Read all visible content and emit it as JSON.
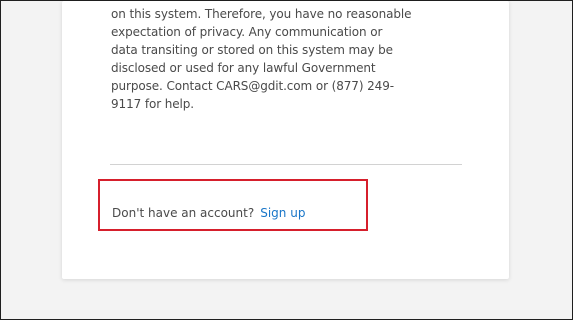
{
  "notice": {
    "lines": [
      "on this system. Therefore, you have no reasonable",
      "expectation of privacy. Any communication or",
      "data transiting or stored on this system may be",
      "disclosed or used for any lawful Government",
      "purpose. Contact CARS@gdit.com or (877) 249-",
      "9117 for help."
    ]
  },
  "signup": {
    "prompt": "Don't have an account?",
    "link_label": "Sign up"
  },
  "colors": {
    "highlight_border": "#d61f2c",
    "link": "#1976c8",
    "text": "#4a4a4a"
  }
}
